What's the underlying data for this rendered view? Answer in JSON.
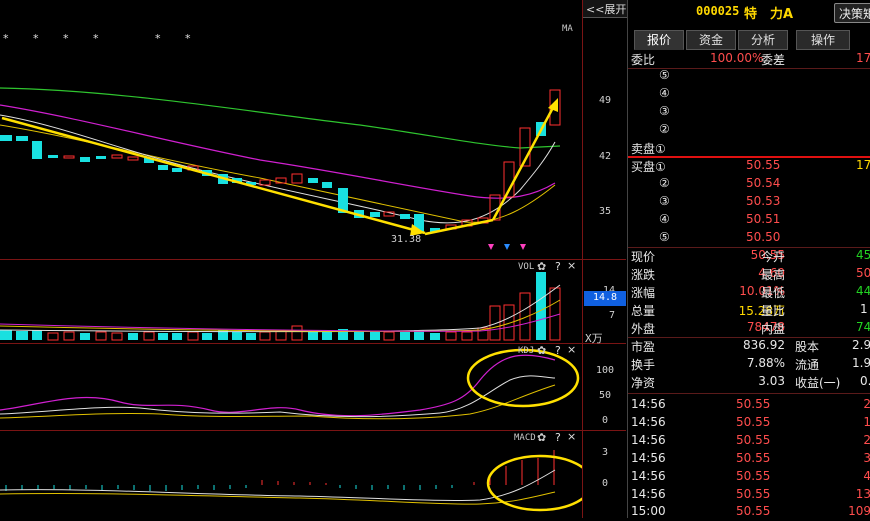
{
  "header": {
    "expand_label": "<<展开",
    "stock_code": "000025",
    "stock_name": "特　力A",
    "decision_button": "决策矩"
  },
  "chart": {
    "ma_label": "MA",
    "price_ticks": [
      "49",
      "42",
      "35"
    ],
    "low_annotation": "31.38",
    "vol_label": "VOL",
    "vol_ticks": [
      "14",
      "7"
    ],
    "vol_marker": "14.8",
    "vol_unit": "X万",
    "kdj_label": "KDJ",
    "kdj_ticks": [
      "100",
      "50",
      "0"
    ],
    "macd_label": "MACD",
    "macd_ticks": [
      "3",
      "0"
    ],
    "help_glyph": "?",
    "close_glyph": "×",
    "gear_glyph": "✿",
    "stars": [
      "*",
      "*",
      "*",
      "*",
      "*",
      "*"
    ]
  },
  "tabs": [
    {
      "label": "报价",
      "active": true
    },
    {
      "label": "资金",
      "active": false
    },
    {
      "label": "分析",
      "active": false
    },
    {
      "label": "操作",
      "active": false
    }
  ],
  "order_book": {
    "weibi_label": "委比",
    "weibi_value": "100.00%",
    "weicha_label": "委差",
    "weicha_value": "17",
    "sell_levels": [
      {
        "label": "⑤",
        "price": "",
        "vol": ""
      },
      {
        "label": "④",
        "price": "",
        "vol": ""
      },
      {
        "label": "③",
        "price": "",
        "vol": ""
      },
      {
        "label": "②",
        "price": "",
        "vol": ""
      },
      {
        "label": "卖盘①",
        "price": "",
        "vol": ""
      }
    ],
    "buy_levels": [
      {
        "label": "买盘①",
        "price": "50.55",
        "vol": "17"
      },
      {
        "label": "②",
        "price": "50.54",
        "vol": ""
      },
      {
        "label": "③",
        "price": "50.53",
        "vol": ""
      },
      {
        "label": "④",
        "price": "50.51",
        "vol": ""
      },
      {
        "label": "⑤",
        "price": "50.50",
        "vol": ""
      }
    ]
  },
  "quote": [
    {
      "l1": "现价",
      "v1": "50.55",
      "c1": "red",
      "l2": "今开",
      "v2": "45",
      "c2": "grn"
    },
    {
      "l1": "涨跌",
      "v1": "4.60",
      "c1": "red",
      "l2": "最高",
      "v2": "50",
      "c2": "red"
    },
    {
      "l1": "涨幅",
      "v1": "10.01%",
      "c1": "red",
      "l2": "最低",
      "v2": "44",
      "c2": "grn"
    },
    {
      "l1": "总量",
      "v1": "15.28万",
      "c1": "yel",
      "l2": "量比",
      "v2": "1",
      "c2": "wht"
    },
    {
      "l1": "外盘",
      "v1": "78478",
      "c1": "red",
      "l2": "内盘",
      "v2": "74",
      "c2": "grn"
    }
  ],
  "fundamentals": [
    {
      "l1": "市盈",
      "v1": "836.92",
      "l2": "股本",
      "v2": "2.9"
    },
    {
      "l1": "换手",
      "v1": "7.88%",
      "l2": "流通",
      "v2": "1.9"
    },
    {
      "l1": "净资",
      "v1": "3.03",
      "l2": "收益(一)",
      "v2": "0."
    }
  ],
  "ticks": [
    {
      "time": "14:56",
      "price": "50.55",
      "vol": "2"
    },
    {
      "time": "14:56",
      "price": "50.55",
      "vol": "1"
    },
    {
      "time": "14:56",
      "price": "50.55",
      "vol": "2"
    },
    {
      "time": "14:56",
      "price": "50.55",
      "vol": "3"
    },
    {
      "time": "14:56",
      "price": "50.55",
      "vol": "4"
    },
    {
      "time": "14:56",
      "price": "50.55",
      "vol": "13"
    },
    {
      "time": "15:00",
      "price": "50.55",
      "vol": "109"
    }
  ]
}
